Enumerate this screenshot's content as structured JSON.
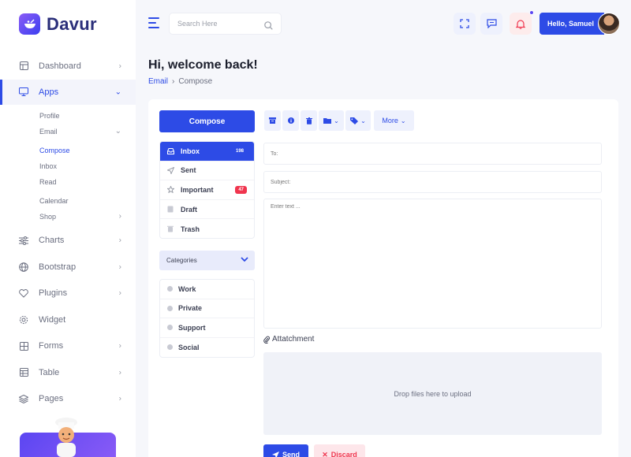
{
  "brand": {
    "name": "Davur"
  },
  "colors": {
    "primary": "#2d4be6",
    "danger": "#f0354e",
    "sidebar_bg": "#ffffff",
    "page_bg": "#f6f7fb"
  },
  "sidebar": {
    "items": [
      {
        "label": "Dashboard",
        "icon": "dashboard-icon",
        "has_chevron": true
      },
      {
        "label": "Apps",
        "icon": "monitor-icon",
        "has_chevron": true,
        "active": true
      },
      {
        "label": "Charts",
        "icon": "sliders-icon",
        "has_chevron": true
      },
      {
        "label": "Bootstrap",
        "icon": "globe-icon",
        "has_chevron": true
      },
      {
        "label": "Plugins",
        "icon": "heart-icon",
        "has_chevron": true
      },
      {
        "label": "Widget",
        "icon": "gear-icon",
        "has_chevron": false
      },
      {
        "label": "Forms",
        "icon": "grid-icon",
        "has_chevron": true
      },
      {
        "label": "Table",
        "icon": "table-icon",
        "has_chevron": true
      },
      {
        "label": "Pages",
        "icon": "layers-icon",
        "has_chevron": true
      }
    ],
    "apps_sub": {
      "profile": "Profile",
      "email": "Email",
      "email_children": [
        "Compose",
        "Inbox",
        "Read"
      ],
      "calendar": "Calendar",
      "shop": "Shop"
    }
  },
  "header": {
    "search_placeholder": "Search Here",
    "greeting": "Hello, Samuel"
  },
  "page": {
    "title": "Hi, welcome back!",
    "breadcrumb": [
      "Email",
      "Compose"
    ]
  },
  "mail": {
    "compose_label": "Compose",
    "folders": [
      {
        "label": "Inbox",
        "badge": "198",
        "icon": "inbox-icon",
        "active": true
      },
      {
        "label": "Sent",
        "badge": "",
        "icon": "paper-plane-icon"
      },
      {
        "label": "Important",
        "badge": "47",
        "icon": "star-icon"
      },
      {
        "label": "Draft",
        "badge": "",
        "icon": "draft-icon"
      },
      {
        "label": "Trash",
        "badge": "",
        "icon": "trash-icon"
      }
    ],
    "categories_label": "Categories",
    "categories": [
      "Work",
      "Private",
      "Support",
      "Social"
    ],
    "toolbar": {
      "more_label": "More"
    },
    "form": {
      "to_placeholder": "To:",
      "subject_placeholder": "Subject:",
      "body_placeholder": "Enter text ...",
      "attachment_label": "Attatchment",
      "dropzone_text": "Drop files here to upload",
      "send_label": "Send",
      "discard_label": "Discard"
    }
  }
}
